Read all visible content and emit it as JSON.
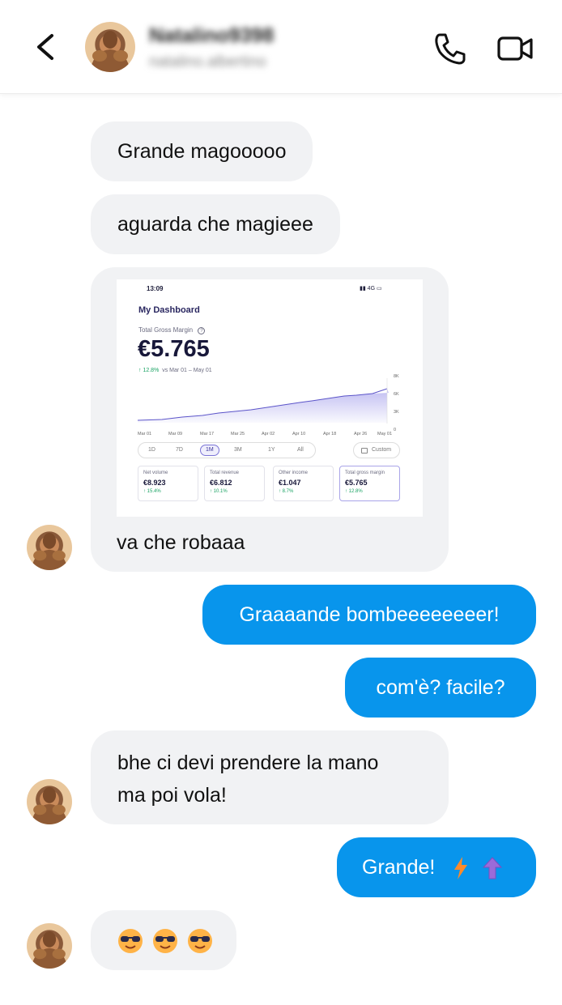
{
  "header": {
    "name": "Natalino9398",
    "username": "natalino.albertino"
  },
  "messages": [
    {
      "text": "Grande magooooo"
    },
    {
      "text": "aguarda che magieee"
    },
    {
      "text": "va che robaaa"
    },
    {
      "text": "Graaaande bombeeeeeeeer!"
    },
    {
      "text": "com'è? facile?"
    },
    {
      "text": "bhe ci devi prendere la mano"
    },
    {
      "text": "ma poi vola!"
    },
    {
      "text": "Grande!"
    }
  ],
  "dashboard": {
    "time": "13:09",
    "status": "4G",
    "title": "My Dashboard",
    "gm_label": "Total Gross Margin",
    "gm_value": "€5.765",
    "gm_pct": "12.8%",
    "gm_vs": "vs Mar 01 – May 01",
    "x_ticks": [
      "Mar 01",
      "Mar 09",
      "Mar 17",
      "Mar 25",
      "Apr 02",
      "Apr 10",
      "Apr 18",
      "Apr 26",
      "May 01"
    ],
    "y_ticks": [
      "8K",
      "6K",
      "3K",
      "0"
    ],
    "ranges": [
      "1D",
      "7D",
      "1M",
      "3M",
      "1Y",
      "All"
    ],
    "custom": "Custom",
    "cards": [
      {
        "label": "Net volume",
        "value": "€8.923",
        "delta": "15.4%"
      },
      {
        "label": "Total revenue",
        "value": "€6.812",
        "delta": "10.1%"
      },
      {
        "label": "Other income",
        "value": "€1.047",
        "delta": "8.7%"
      },
      {
        "label": "Total gross margin",
        "value": "€5.765",
        "delta": "12.8%"
      }
    ]
  },
  "colors": {
    "outgoing": "#0895ec",
    "incoming": "#f1f2f4",
    "chart_line": "#5b54c9"
  }
}
